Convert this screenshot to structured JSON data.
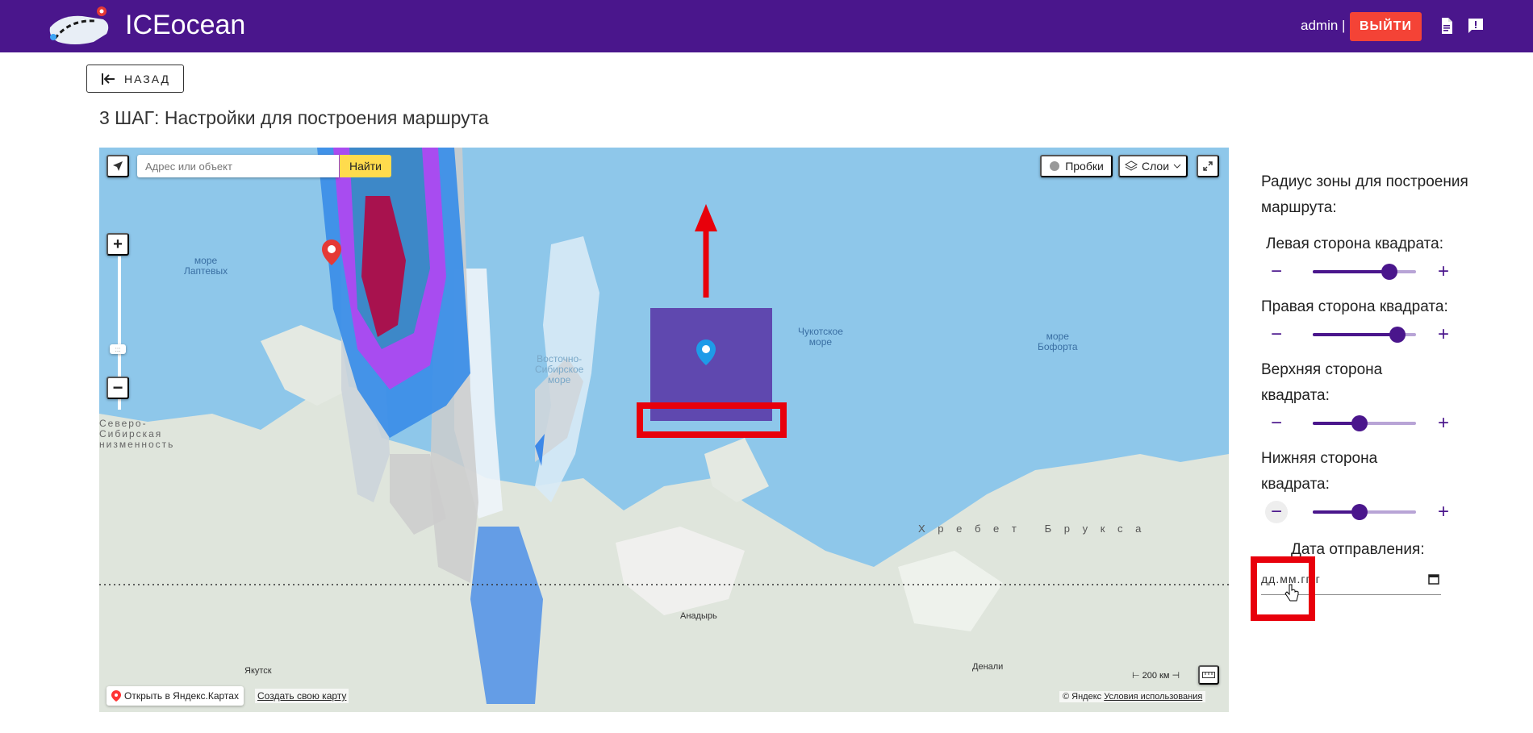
{
  "header": {
    "brand": "ICEocean",
    "user": "admin |",
    "logout_label": "ВЫЙТИ",
    "icons": [
      "document-icon",
      "feedback-icon"
    ],
    "accent_color": "#4a168c",
    "logout_color": "#f44336"
  },
  "back_button": {
    "label": "НАЗАД"
  },
  "step_title": "3 ШАГ: Настройки для построения маршрута",
  "map": {
    "search_placeholder": "Адрес или объект",
    "find_label": "Найти",
    "traffic_label": "Пробки",
    "layers_label": "Слои",
    "labels": {
      "laptev": "море\nЛаптевых",
      "east_siberian": "Восточно-\nСибирское\nморе",
      "chukchi": "Чукотское\nморе",
      "beaufort": "море\nБофорта",
      "north_siberian": "Северо-\nСибирская\nнизменность",
      "brooks": "Х р е б е т   Б р у к с а",
      "anadyr": "Анадырь",
      "yakutsk": "Якутск",
      "denali": "Денали"
    },
    "scale": "200 км",
    "open_in_yandex": "Открыть в Яндекс.Картах",
    "create_map": "Создать свою карту",
    "copyright": "© Яндекс",
    "terms": "Условия использования"
  },
  "sidebar": {
    "title": "Радиус зоны для построения маршрута:",
    "sliders": [
      {
        "label": "Левая сторона квадрата:",
        "value": 0.74
      },
      {
        "label": "Правая сторона квадрата:",
        "value": 0.82
      },
      {
        "label": "Верхняя сторона квадрата:",
        "value": 0.45
      },
      {
        "label": "Нижняя сторона квадрата:",
        "value": 0.45
      }
    ],
    "minus_label": "−",
    "plus_label": "+",
    "date_label": "Дата отправления:",
    "date_placeholder": "дд.мм.гггг"
  }
}
